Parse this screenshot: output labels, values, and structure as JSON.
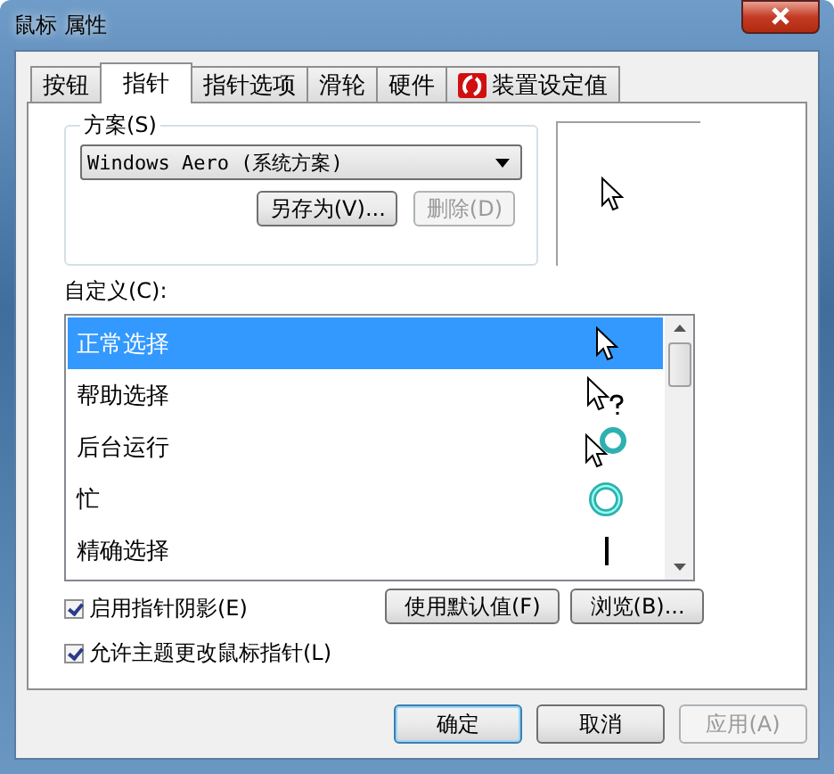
{
  "window": {
    "title": "鼠标 属性"
  },
  "tabs": [
    {
      "label": "按钮",
      "selected": false,
      "kind": "text"
    },
    {
      "label": "指针",
      "selected": true,
      "kind": "text"
    },
    {
      "label": "指针选项",
      "selected": false,
      "kind": "text"
    },
    {
      "label": "滑轮",
      "selected": false,
      "kind": "text"
    },
    {
      "label": "硬件",
      "selected": false,
      "kind": "text"
    },
    {
      "label": "装置设定值",
      "selected": false,
      "kind": "device"
    }
  ],
  "scheme": {
    "label": "方案(S)",
    "value": "Windows Aero (系统方案)",
    "buttons": [
      {
        "label": "另存为(V)...",
        "disabled": false
      },
      {
        "label": "删除(D)",
        "disabled": true
      }
    ]
  },
  "customize": {
    "label": "自定义(C):",
    "items": [
      {
        "name": "正常选择",
        "selected": true,
        "kind": "arrow"
      },
      {
        "name": "帮助选择",
        "selected": false,
        "kind": "help"
      },
      {
        "name": "后台运行",
        "selected": false,
        "kind": "working"
      },
      {
        "name": "忙",
        "selected": false,
        "kind": "busy"
      },
      {
        "name": "精确选择",
        "selected": false,
        "kind": "precision"
      }
    ]
  },
  "options": [
    {
      "kind": "checkbox",
      "label": "启用指针阴影(E)",
      "checked": true
    },
    {
      "kind": "buttons",
      "buttons": [
        {
          "label": "使用默认值(F)",
          "disabled": false
        },
        {
          "label": "浏览(B)...",
          "disabled": false
        }
      ]
    }
  ],
  "theme_checkbox": {
    "label": "允许主题更改鼠标指针(L)",
    "checked": true
  },
  "footer_buttons": [
    {
      "label": "确定",
      "disabled": false,
      "default": true
    },
    {
      "label": "取消",
      "disabled": false,
      "default": false
    },
    {
      "label": "应用(A)",
      "disabled": true,
      "default": false
    }
  ]
}
